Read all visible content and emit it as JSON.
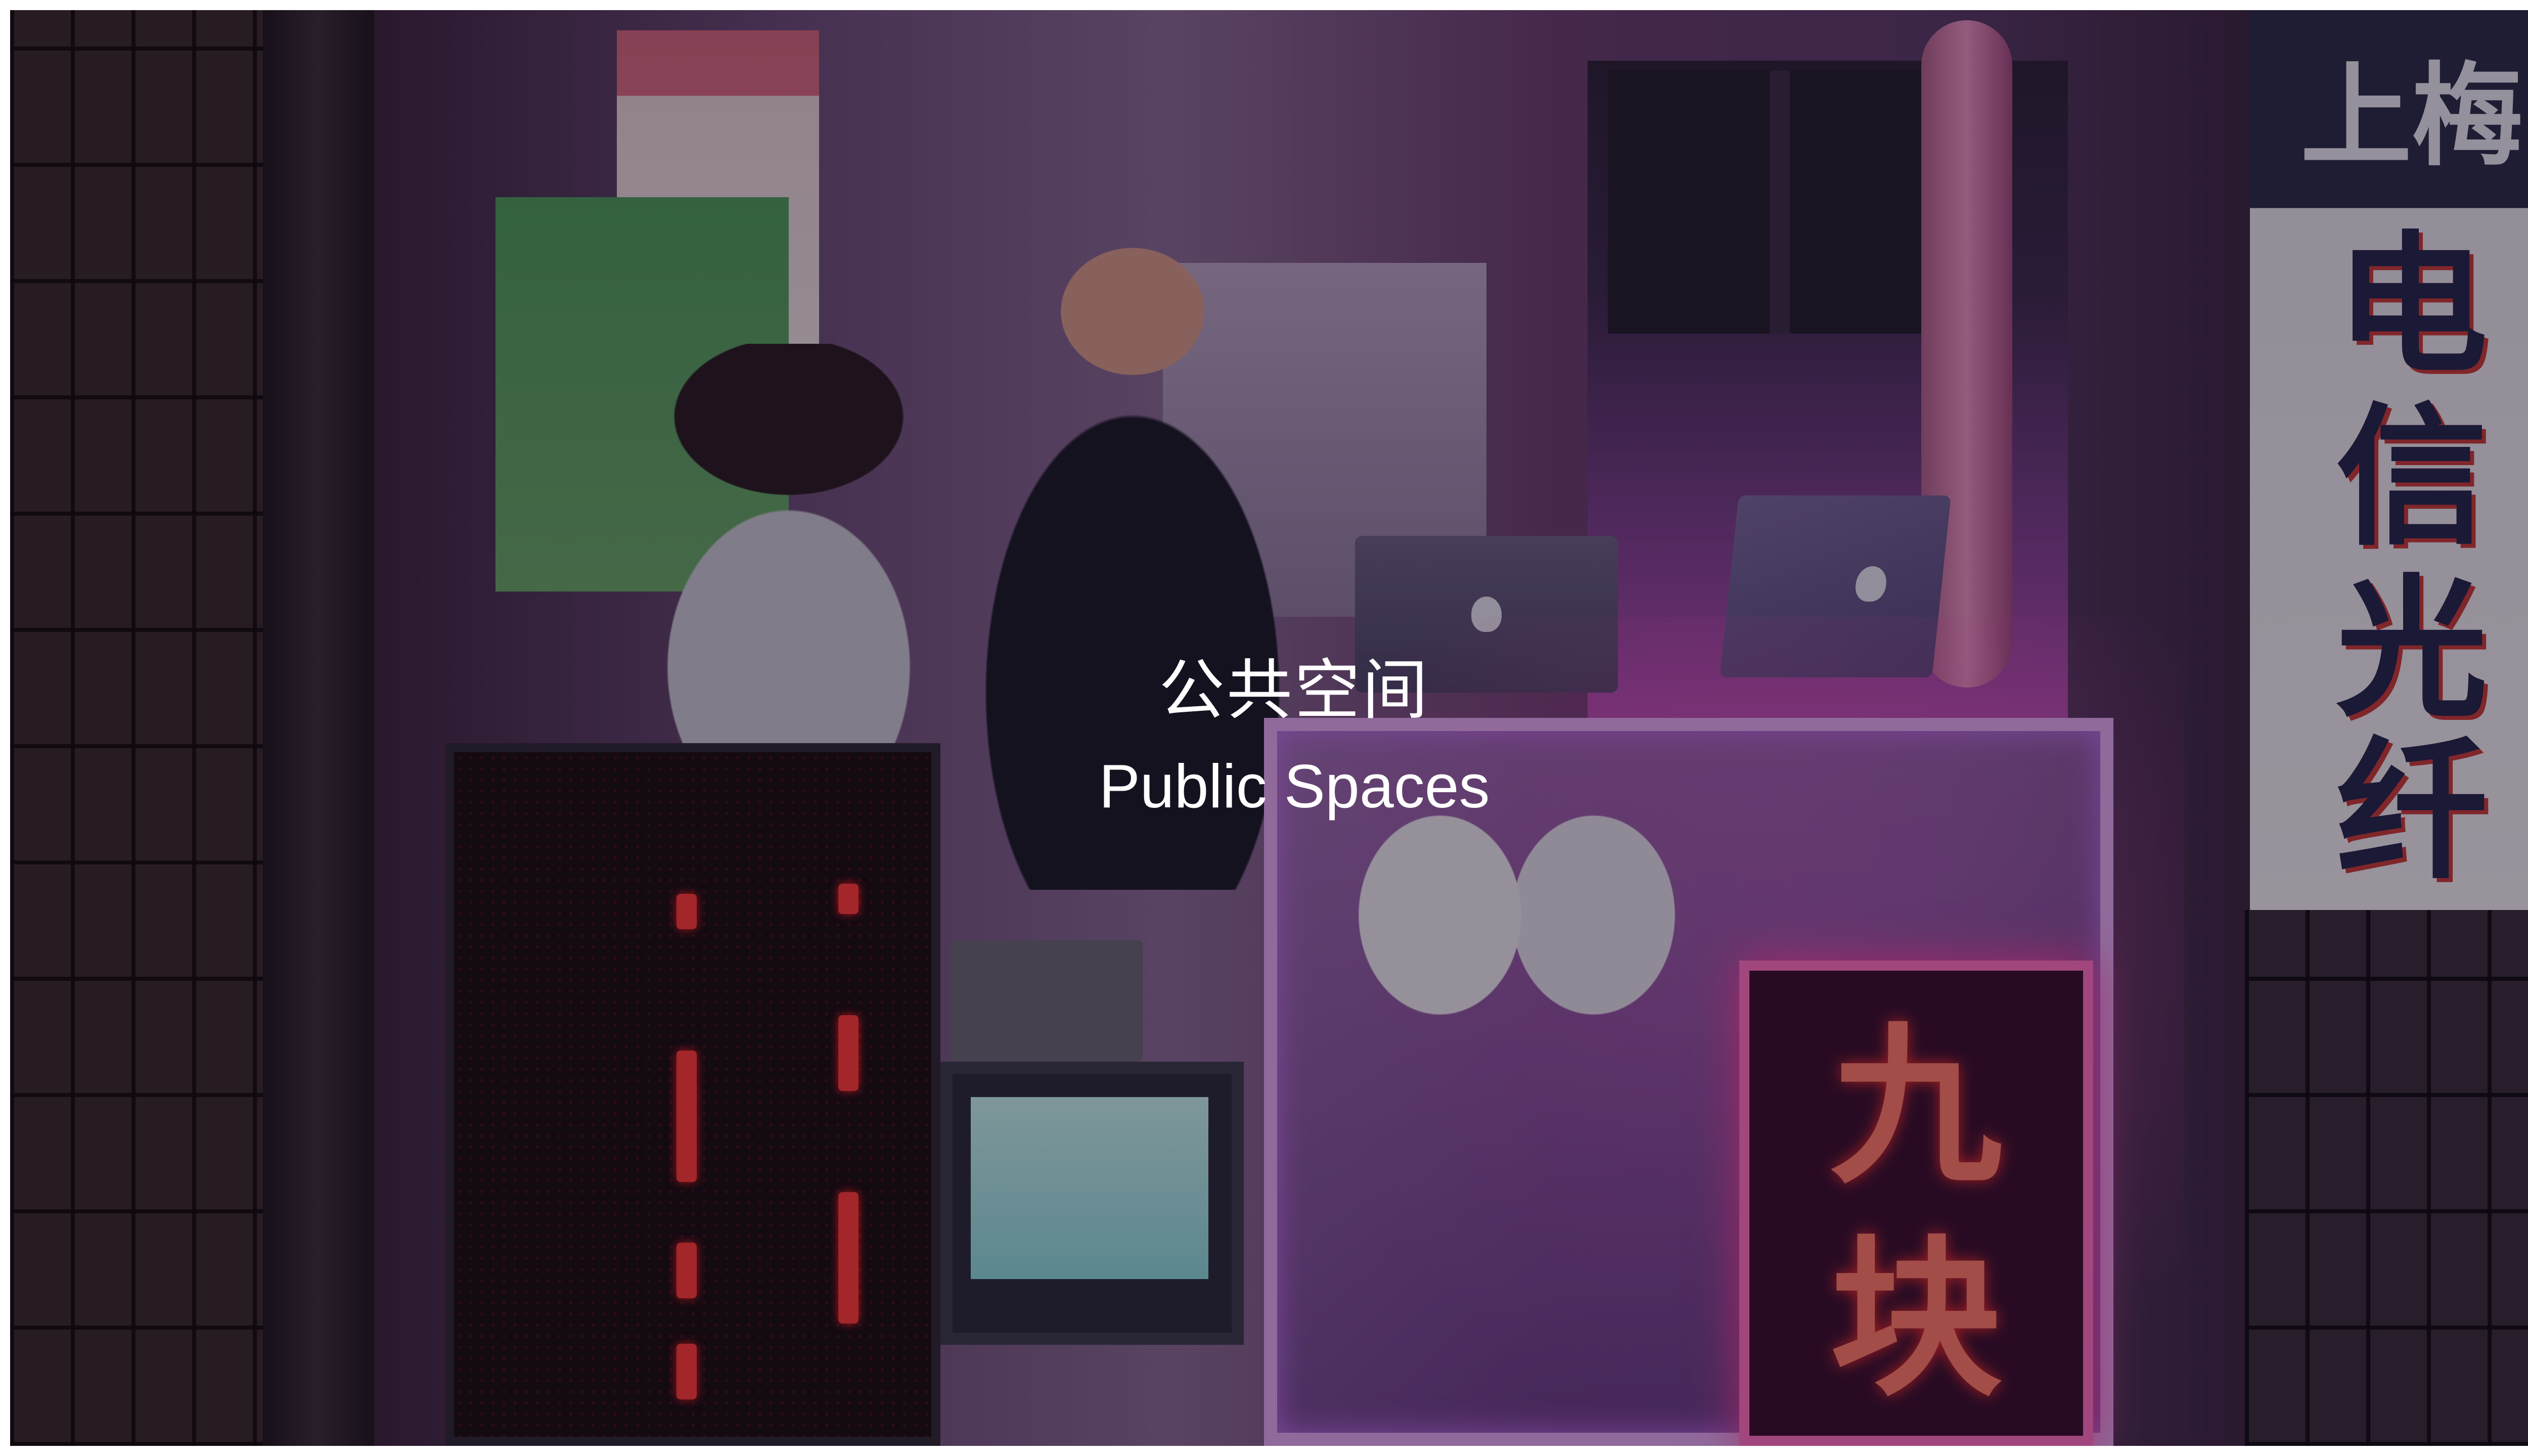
{
  "title": {
    "chinese": "公共空间",
    "english": "Public Spaces"
  },
  "photo_signs": {
    "right_board_top": "上梅",
    "right_board_chars": [
      "电",
      "信",
      "光",
      "纤"
    ],
    "neon_sign_chars": "九块"
  },
  "colors": {
    "overlay": "#0a050f",
    "title_text": "#ffffff",
    "neon_pink": "#ff6ec2",
    "neon_red": "#ff3a3a"
  }
}
